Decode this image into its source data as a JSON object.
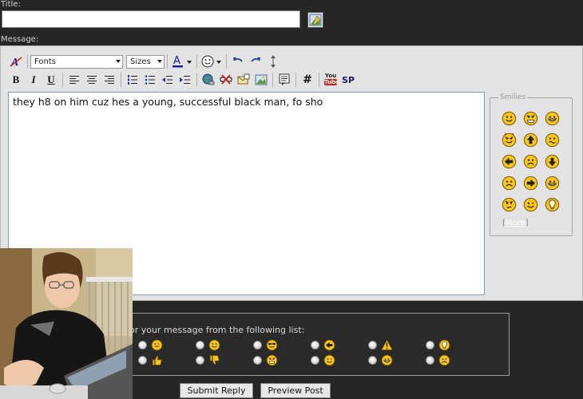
{
  "form": {
    "title_label": "Title:",
    "title_value": "",
    "message_label": "Message:"
  },
  "toolbar": {
    "fonts_value": "Fonts",
    "sizes_value": "Sizes",
    "bold_label": "B",
    "italic_label": "I",
    "underline_label": "U",
    "hash_label": "#",
    "youtube_label_top": "You",
    "youtube_label_bottom": "Tube",
    "sp_label": "SP",
    "font_color_letter": "A",
    "font_color_accent": "#1a1aa0"
  },
  "message": {
    "text": "they h8 on him cuz hes a young, successful black man, fo sho"
  },
  "smilies": {
    "legend": "Smilies",
    "more_label": "More",
    "icons": [
      "smile",
      "mad",
      "grin",
      "devil",
      "up-arrow",
      "confused",
      "left-arrow",
      "sad",
      "down-arrow",
      "frown",
      "right-arrow",
      "big-grin",
      "worried",
      "wink",
      "idea"
    ]
  },
  "post_icons": {
    "label": "or your message from the following list:",
    "icons": [
      "tongue",
      "smile",
      "cool",
      "left-arrow",
      "exclamation",
      "idea",
      "thumbs-up",
      "thumbs-down",
      "mad",
      "wink",
      "grin",
      "sad"
    ]
  },
  "buttons": {
    "submit": "Submit Reply",
    "preview": "Preview Post"
  },
  "colors": {
    "page_bg": "#262626",
    "panel_bg": "#e3e3e3",
    "smiley_yellow": "#f7c51c",
    "textarea_border": "#7f9db9"
  }
}
